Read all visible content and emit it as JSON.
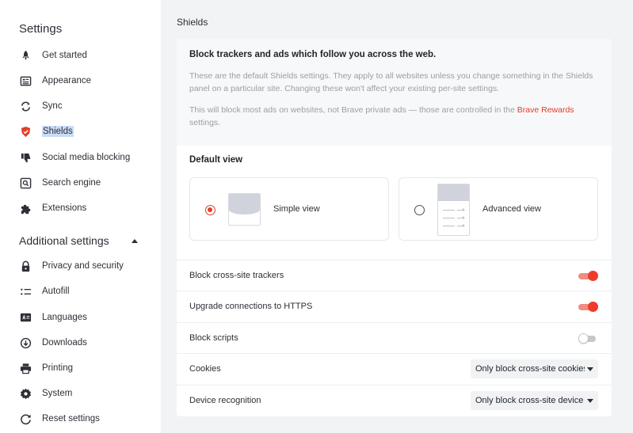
{
  "sidebar": {
    "title": "Settings",
    "items": [
      {
        "label": "Get started",
        "icon": "rocket-icon"
      },
      {
        "label": "Appearance",
        "icon": "appearance-icon"
      },
      {
        "label": "Sync",
        "icon": "sync-icon"
      },
      {
        "label": "Shields",
        "icon": "shield-icon",
        "selected": true
      },
      {
        "label": "Social media blocking",
        "icon": "thumbs-down-icon"
      },
      {
        "label": "Search engine",
        "icon": "search-icon"
      },
      {
        "label": "Extensions",
        "icon": "puzzle-icon"
      }
    ],
    "additional_label": "Additional settings",
    "additional_items": [
      {
        "label": "Privacy and security",
        "icon": "lock-icon"
      },
      {
        "label": "Autofill",
        "icon": "list-icon"
      },
      {
        "label": "Languages",
        "icon": "language-icon"
      },
      {
        "label": "Downloads",
        "icon": "download-icon"
      },
      {
        "label": "Printing",
        "icon": "printer-icon"
      },
      {
        "label": "System",
        "icon": "gear-icon"
      },
      {
        "label": "Reset settings",
        "icon": "reset-icon"
      }
    ]
  },
  "main": {
    "title": "Shields",
    "intro": {
      "heading": "Block trackers and ads which follow you across the web.",
      "p1": "These are the default Shields settings. They apply to all websites unless you change something in the Shields panel on a particular site. Changing these won't affect your existing per-site settings.",
      "p2_before": "This will block most ads on websites, not Brave private ads — those are controlled in the ",
      "p2_link": "Brave Rewards",
      "p2_after": " settings."
    },
    "default_view": {
      "title": "Default view",
      "simple_label": "Simple view",
      "advanced_label": "Advanced view",
      "selected": "simple"
    },
    "rows": {
      "cross_site": {
        "label": "Block cross-site trackers",
        "on": true
      },
      "https": {
        "label": "Upgrade connections to HTTPS",
        "on": true
      },
      "scripts": {
        "label": "Block scripts",
        "on": false
      },
      "cookies": {
        "label": "Cookies",
        "value": "Only block cross-site cookies"
      },
      "device": {
        "label": "Device recognition",
        "value": "Only block cross-site device recognition"
      }
    }
  },
  "colors": {
    "accent": "#e33d2b",
    "selection": "#c9dcf7"
  }
}
